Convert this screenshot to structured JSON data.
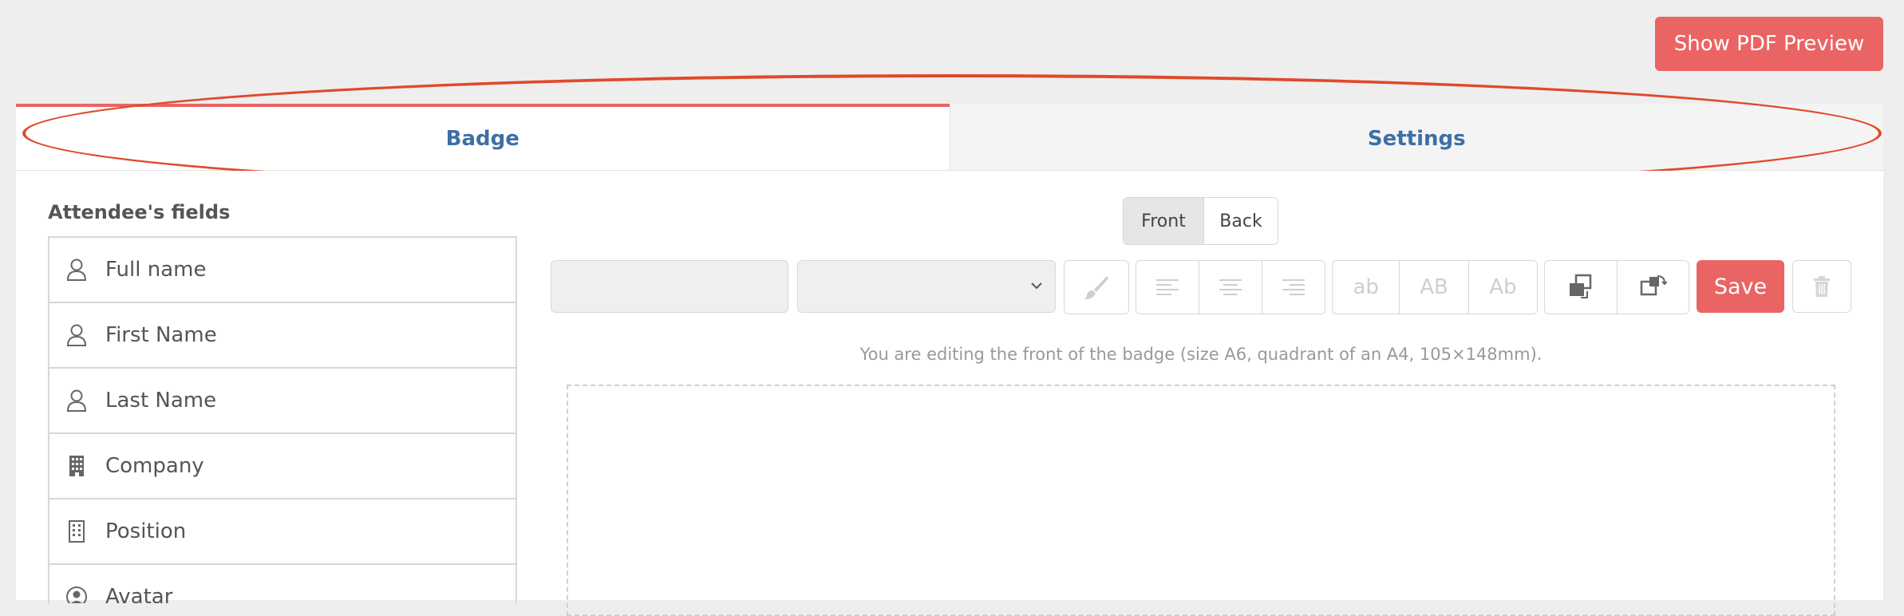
{
  "header": {
    "pdf_preview_label": "Show PDF Preview"
  },
  "tabs": [
    {
      "label": "Badge",
      "active": true
    },
    {
      "label": "Settings",
      "active": false
    }
  ],
  "sidebar": {
    "title": "Attendee's fields",
    "items": [
      {
        "label": "Full name",
        "icon": "user-icon"
      },
      {
        "label": "First Name",
        "icon": "user-icon"
      },
      {
        "label": "Last Name",
        "icon": "user-icon"
      },
      {
        "label": "Company",
        "icon": "building-icon"
      },
      {
        "label": "Position",
        "icon": "building-outline-icon"
      },
      {
        "label": "Avatar",
        "icon": "avatar-icon"
      }
    ]
  },
  "side_toggle": {
    "front": "Front",
    "back": "Back"
  },
  "toolbar": {
    "case_lower": "ab",
    "case_upper": "AB",
    "case_title": "Ab",
    "save_label": "Save"
  },
  "editor": {
    "hint": "You are editing the front of the badge (size A6, quadrant of an A4, 105×148mm)."
  },
  "colors": {
    "accent": "#ea6464",
    "link": "#3d6fa7",
    "annotation": "#e04a2a"
  }
}
